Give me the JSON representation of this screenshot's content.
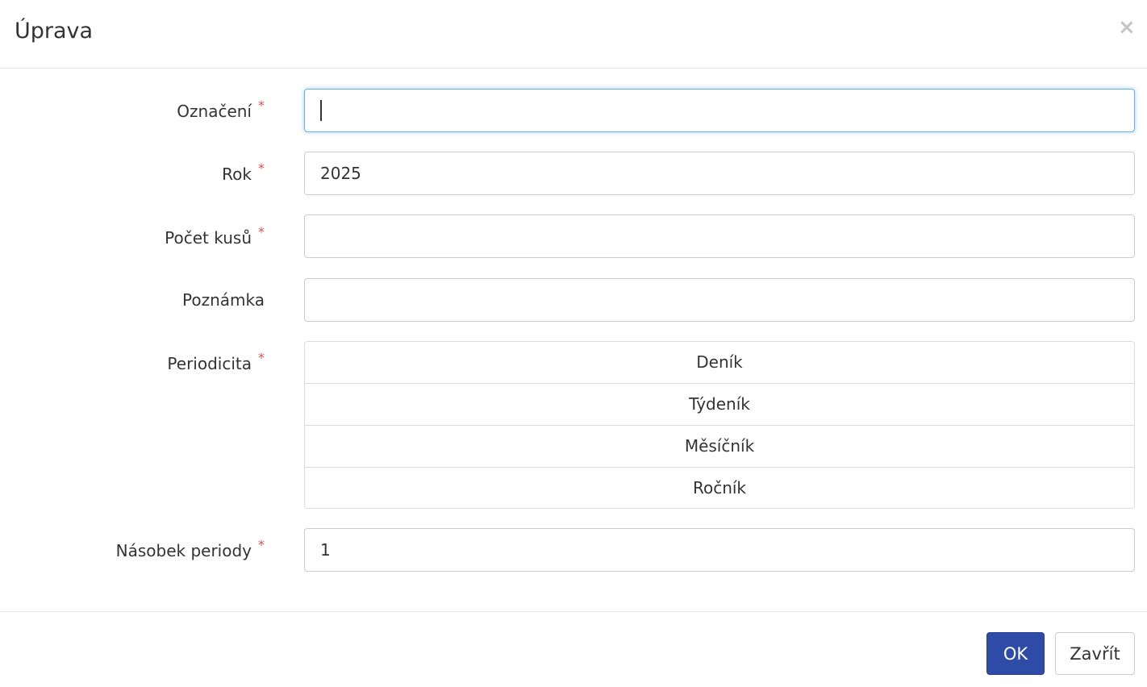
{
  "dialog": {
    "title": "Úprava",
    "close_icon": "×"
  },
  "form": {
    "oznaceni": {
      "label": "Označení",
      "required_mark": "*",
      "value": ""
    },
    "rok": {
      "label": "Rok",
      "required_mark": "*",
      "value": "2025"
    },
    "pocet_kusu": {
      "label": "Počet kusů",
      "required_mark": "*",
      "value": ""
    },
    "poznamka": {
      "label": "Poznámka",
      "value": ""
    },
    "periodicita": {
      "label": "Periodicita",
      "required_mark": "*",
      "options": [
        "Deník",
        "Týdeník",
        "Měsíčník",
        "Ročník"
      ]
    },
    "nasobek_periody": {
      "label": "Násobek periody",
      "required_mark": "*",
      "value": "1"
    }
  },
  "footer": {
    "ok_label": "OK",
    "close_label": "Zavřít"
  },
  "colors": {
    "primary": "#2f4ba8",
    "required": "#d9534f",
    "focus_border": "#66afe9"
  }
}
